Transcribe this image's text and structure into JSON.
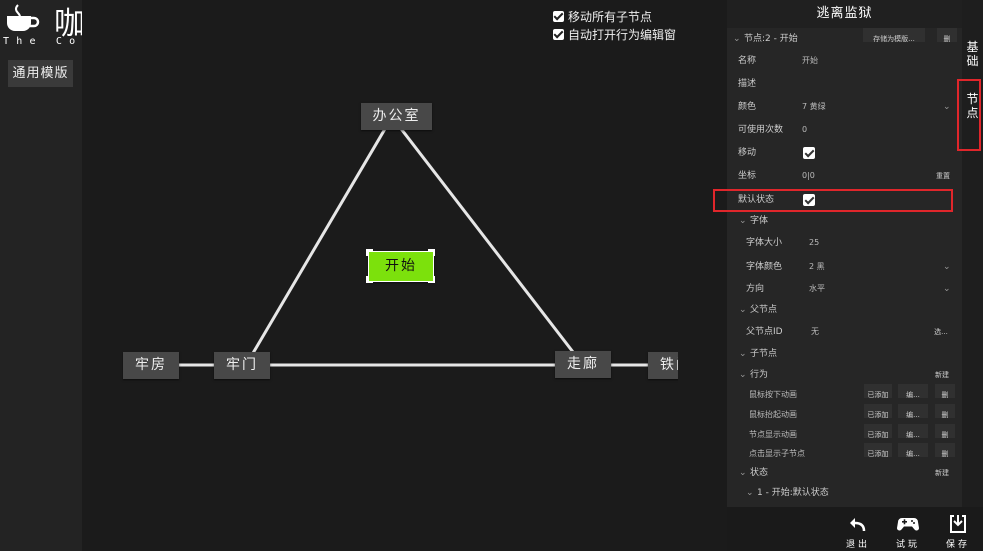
{
  "logo": {
    "title": "咖啡剧场",
    "subtitle": "The Coffee theater"
  },
  "sidebar": {
    "template_button": "通用模版"
  },
  "canvas": {
    "checkboxes": [
      {
        "label": "移动所有子节点",
        "checked": true
      },
      {
        "label": "自动打开行为编辑窗",
        "checked": true
      }
    ],
    "nodes": {
      "office": "办公室",
      "start": "开始",
      "cell": "牢房",
      "gate": "牢门",
      "corridor": "走廊",
      "iron": "铁门"
    }
  },
  "panel": {
    "title": "逃离监狱",
    "node_header": {
      "label": "节点:2 - 开始",
      "save_template": "存储为模版...",
      "delete": "删"
    },
    "fields": {
      "name_label": "名称",
      "name_value": "开始",
      "desc_label": "描述",
      "color_label": "颜色",
      "color_value": "7 黄绿",
      "uses_label": "可使用次数",
      "uses_value": "0",
      "move_label": "移动",
      "move_checked": true,
      "coord_label": "坐标",
      "coord_value": "0|0",
      "coord_reset": "重置",
      "default_label": "默认状态",
      "default_checked": true
    },
    "font_section": {
      "label": "字体",
      "size_label": "字体大小",
      "size_value": "25",
      "color_label": "字体颜色",
      "color_value": "2 黑",
      "dir_label": "方向",
      "dir_value": "水平"
    },
    "parent_section": {
      "label": "父节点",
      "id_label": "父节点ID",
      "id_value": "无",
      "select": "选..."
    },
    "child_section": {
      "label": "子节点"
    },
    "behavior_section": {
      "label": "行为",
      "new": "新建",
      "rows": [
        {
          "name": "鼠标按下动画",
          "status": "已添加",
          "edit": "编...",
          "del": "删"
        },
        {
          "name": "鼠标抬起动画",
          "status": "已添加",
          "edit": "编...",
          "del": "删"
        },
        {
          "name": "节点显示动画",
          "status": "已添加",
          "edit": "编...",
          "del": "删"
        },
        {
          "name": "点击显示子节点",
          "status": "已添加",
          "edit": "编...",
          "del": "删"
        }
      ]
    },
    "state_section": {
      "label": "状态",
      "new": "新建",
      "item": "1 - 开始:默认状态"
    }
  },
  "tabs": {
    "basic": "基础",
    "node": "节点"
  },
  "toolbar": {
    "exit": "退出",
    "test": "试玩",
    "save": "保存"
  },
  "colors": {
    "start_node": "#7ce10c",
    "highlight": "#e0262b",
    "node_bg": "#484848"
  }
}
